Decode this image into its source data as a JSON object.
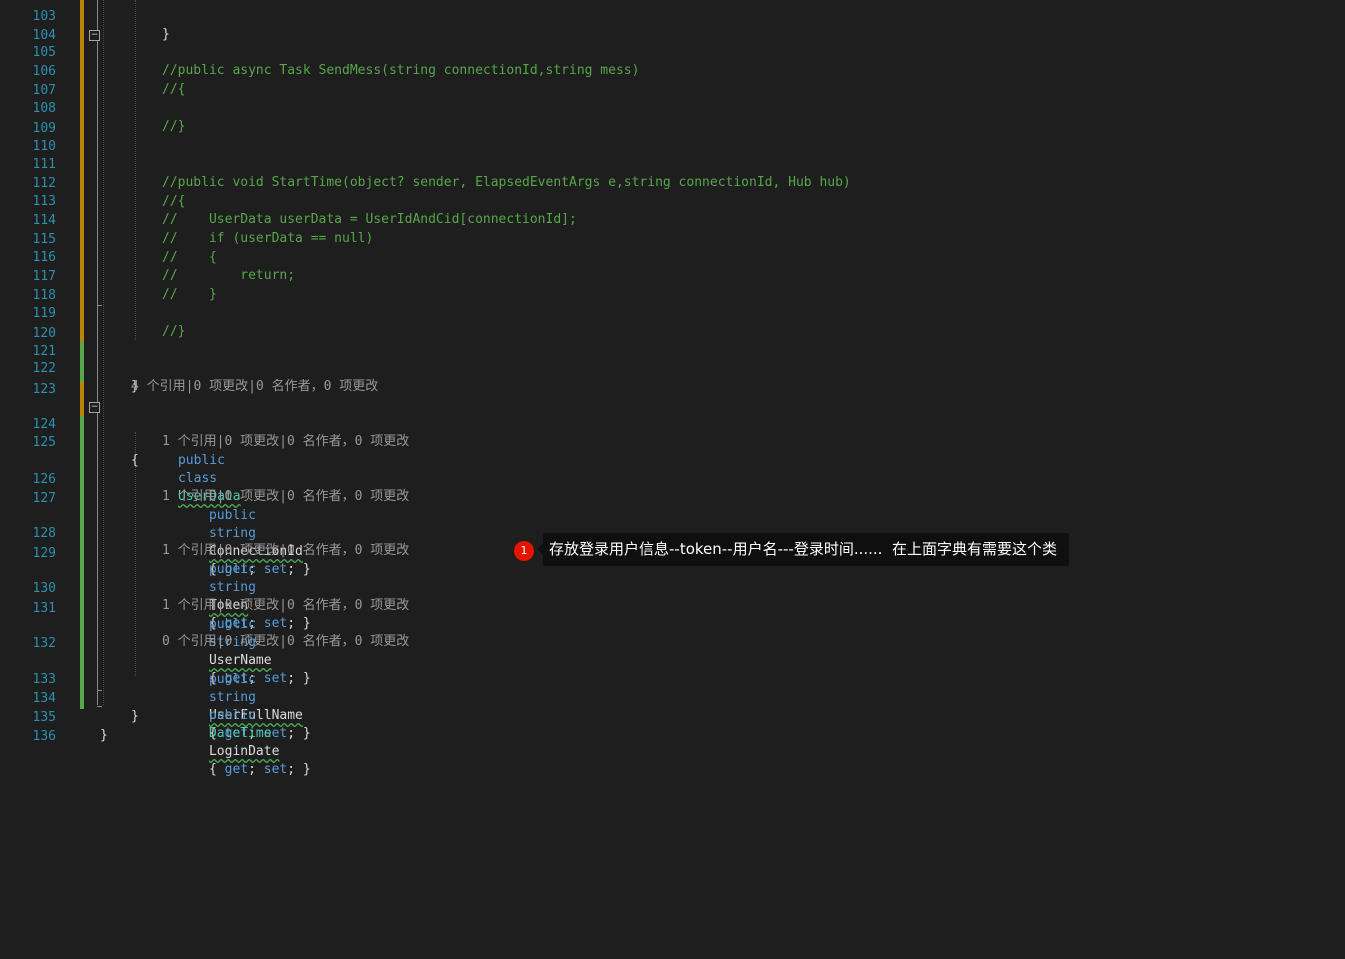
{
  "editor": {
    "lines": {
      "l103": {
        "num": "103",
        "text": "}"
      },
      "l104": {
        "num": "104"
      },
      "l105": {
        "num": "105",
        "text": "//public async Task SendMess(string connectionId,string mess)"
      },
      "l106": {
        "num": "106",
        "text": "//{"
      },
      "l107": {
        "num": "107"
      },
      "l108": {
        "num": "108",
        "text": "//}"
      },
      "l109": {
        "num": "109"
      },
      "l110": {
        "num": "110"
      },
      "l111": {
        "num": "111",
        "text": "//public void StartTime(object? sender, ElapsedEventArgs e,string connectionId, Hub hub)"
      },
      "l112": {
        "num": "112",
        "text": "//{"
      },
      "l113": {
        "num": "113",
        "text": "//    UserData userData = UserIdAndCid[connectionId];"
      },
      "l114": {
        "num": "114",
        "text": "//    if (userData == null)"
      },
      "l115": {
        "num": "115",
        "text": "//    {"
      },
      "l116": {
        "num": "116",
        "text": "//        return;"
      },
      "l117": {
        "num": "117",
        "text": "//    }"
      },
      "l118": {
        "num": "118"
      },
      "l119": {
        "num": "119",
        "text": "//}"
      },
      "l120": {
        "num": "120"
      },
      "l121": {
        "num": "121"
      },
      "l122": {
        "num": "122",
        "text": "}"
      },
      "l123": {
        "num": "123"
      },
      "l124": {
        "num": "124",
        "kw1": "public",
        "kw2": "class",
        "name": "UserData"
      },
      "l125": {
        "num": "125",
        "text": "{"
      },
      "l126": {
        "num": "126",
        "kw1": "public",
        "kw2": "string",
        "name": "ConnectionId",
        "acc_open": "{ ",
        "get": "get",
        "sep1": "; ",
        "set": "set",
        "acc_close": "; }"
      },
      "l127": {
        "num": "127"
      },
      "l128": {
        "num": "128",
        "kw1": "public",
        "kw2": "string",
        "name": "Token",
        "acc_open": "{ ",
        "get": "get",
        "sep1": "; ",
        "set": "set",
        "acc_close": "; }"
      },
      "l129": {
        "num": "129"
      },
      "l130": {
        "num": "130",
        "kw1": "public",
        "kw2": "string",
        "name": "UserName",
        "acc_open": "{ ",
        "get": "get",
        "sep1": "; ",
        "set": "set",
        "acc_close": "; }"
      },
      "l131": {
        "num": "131"
      },
      "l132": {
        "num": "132",
        "kw1": "public",
        "kw2": "string",
        "name": "UserFullName",
        "acc_open": "{ ",
        "get": "get",
        "sep1": "; ",
        "set": "set",
        "acc_close": "; }"
      },
      "l133": {
        "num": "133",
        "kw1": "public",
        "ty": "DateTime",
        "name": "LoginDate",
        "acc_open": "{ ",
        "get": "get",
        "sep1": "; ",
        "set": "set",
        "acc_close": "; }"
      },
      "l134": {
        "num": "134",
        "text": "}"
      },
      "l135": {
        "num": "135",
        "text": "}"
      },
      "l136": {
        "num": "136"
      }
    },
    "codelens": {
      "class_userdata": "4 个引用|0 项更改|0 名作者，0 项更改",
      "prop_connectionid": "1 个引用|0 项更改|0 名作者，0 项更改",
      "prop_token": "1 个引用|0 项更改|0 名作者，0 项更改",
      "prop_username": "1 个引用|0 项更改|0 名作者，0 项更改",
      "prop_userfullname": "1 个引用|0 项更改|0 名作者，0 项更改",
      "prop_logindate": "0 个引用|0 项更改|0 名作者，0 项更改"
    },
    "fold_glyph": "−"
  },
  "tooltip": {
    "badge": "1",
    "text": "存放登录用户信息--token--用户名---登录时间......  在上面字典有需要这个类"
  },
  "colors": {
    "background": "#1e1e1e",
    "line_number": "#2b91af",
    "comment": "#57a64a",
    "keyword": "#569cd6",
    "type": "#4ec9b0",
    "codelens": "#999999",
    "change_bar_green": "#57a64a",
    "change_bar_yellow": "#b8860b",
    "badge": "#e51400"
  }
}
